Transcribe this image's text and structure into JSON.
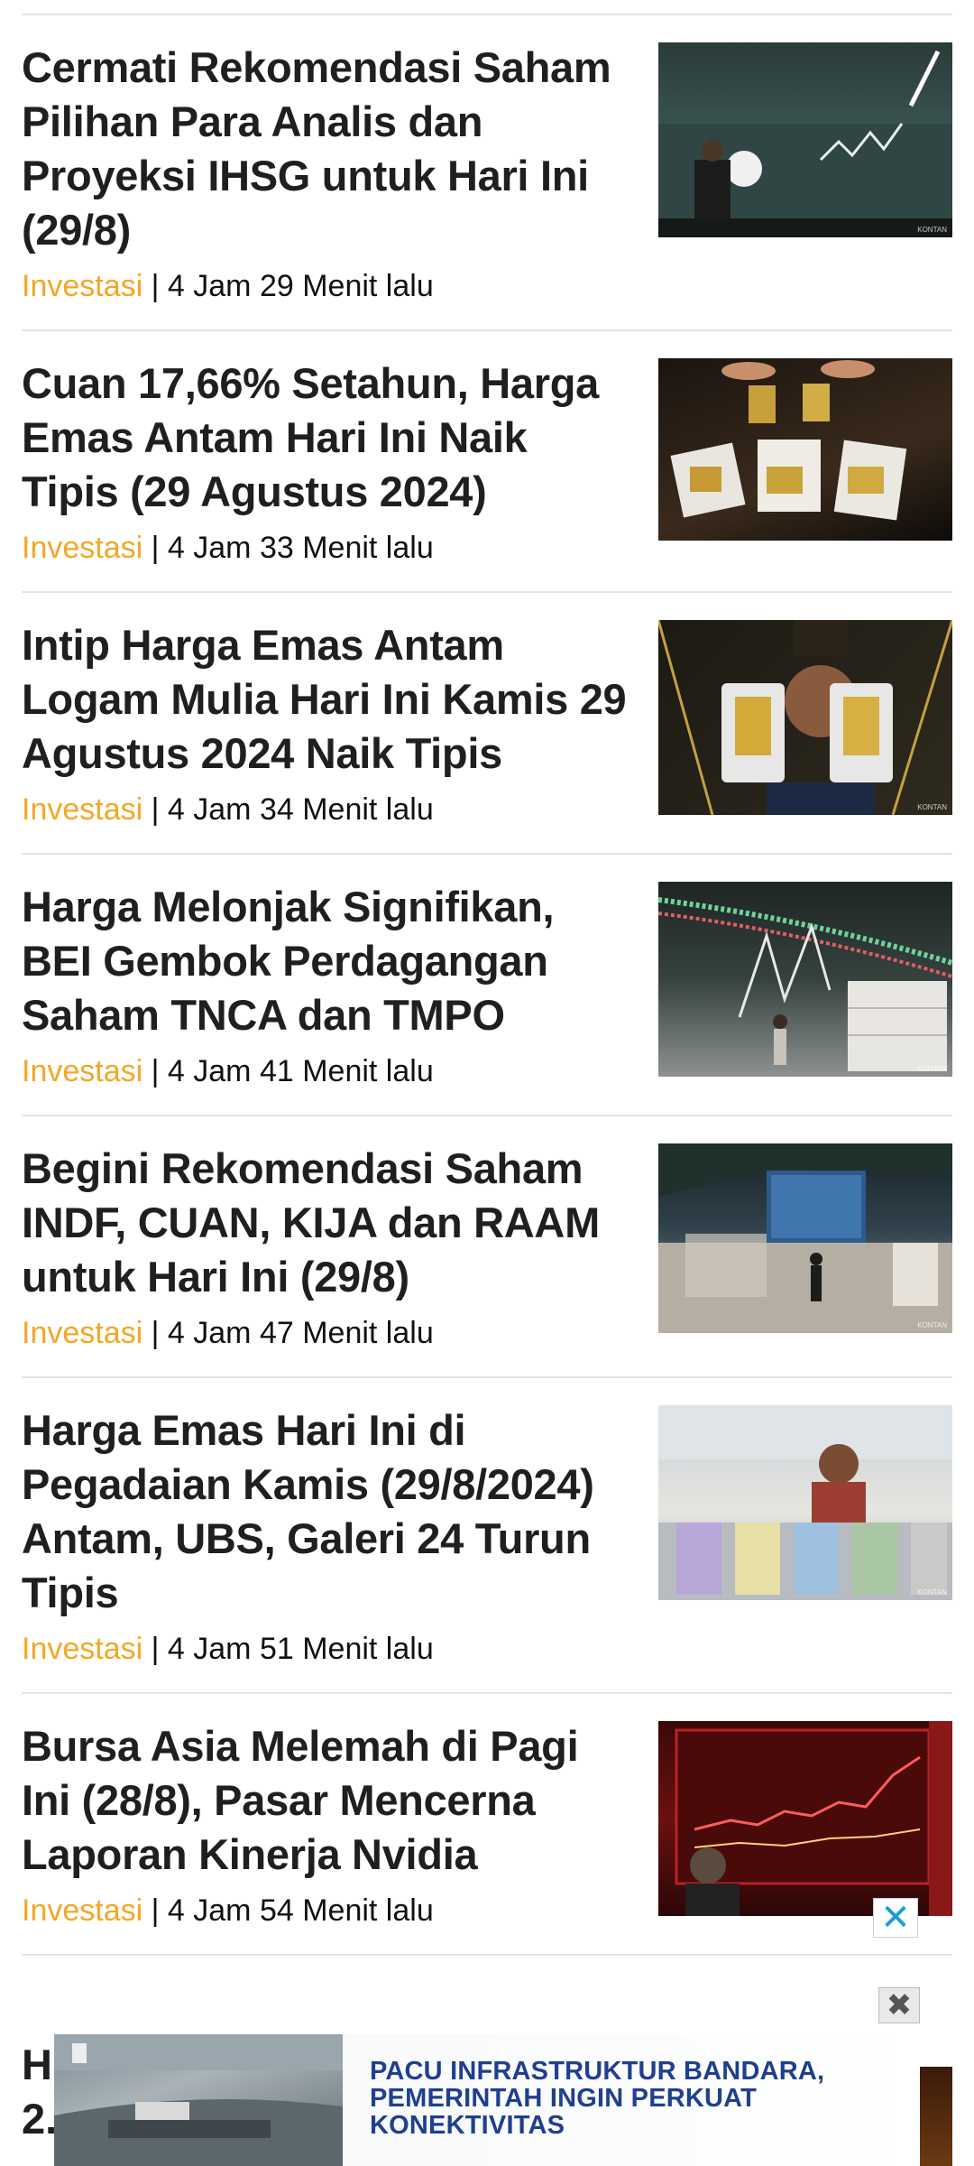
{
  "articles": [
    {
      "title": "Cermati Rekomendasi Saham Pilihan Para Analis dan Proyeksi IHSG untuk Hari Ini (29/8)",
      "category": "Investasi",
      "time": "4 Jam 29 Menit lalu",
      "image": "market-board-photo"
    },
    {
      "title": "Cuan 17,66% Setahun, Harga Emas Antam Hari Ini Naik Tipis (29 Agustus 2024)",
      "category": "Investasi",
      "time": "4 Jam 33 Menit lalu",
      "image": "gold-bars-photo"
    },
    {
      "title": "Intip Harga Emas Antam Logam Mulia Hari Ini Kamis 29 Agustus 2024 Naik Tipis",
      "category": "Investasi",
      "time": "4 Jam 34 Menit lalu",
      "image": "gold-bars-held-photo"
    },
    {
      "title": "Harga Melonjak Signifikan, BEI Gembok Perdagangan Saham TNCA dan TMPO",
      "category": "Investasi",
      "time": "4 Jam 41 Menit lalu",
      "image": "exchange-board-photo"
    },
    {
      "title": "Begini Rekomendasi Saham INDF, CUAN, KIJA dan RAAM untuk Hari Ini (29/8)",
      "category": "Investasi",
      "time": "4 Jam 47 Menit lalu",
      "image": "exchange-hall-photo"
    },
    {
      "title": "Harga Emas Hari Ini di Pegadaian Kamis (29/8/2024) Antam, UBS, Galeri 24 Turun Tipis",
      "category": "Investasi",
      "time": "4 Jam 51 Menit lalu",
      "image": "gold-shop-photo"
    },
    {
      "title": "Bursa Asia Melemah di Pagi Ini (28/8), Pasar Mencerna Laporan Kinerja Nvidia",
      "category": "Investasi",
      "time": "4 Jam 54 Menit lalu",
      "image": "red-board-photo"
    }
  ],
  "meta_separator": " | ",
  "partial_article": {
    "title_visible": "H\n2."
  },
  "ad": {
    "text": "PACU INFRASTRUKTUR BANDARA, PEMERINTAH INGIN PERKUAT KONEKTIVITAS",
    "dismiss_glyph": "✖",
    "close_glyph": "✕"
  },
  "colors": {
    "category": "#f5a623",
    "ad_text": "#1f3f8f",
    "close_x": "#1e9bd7"
  }
}
